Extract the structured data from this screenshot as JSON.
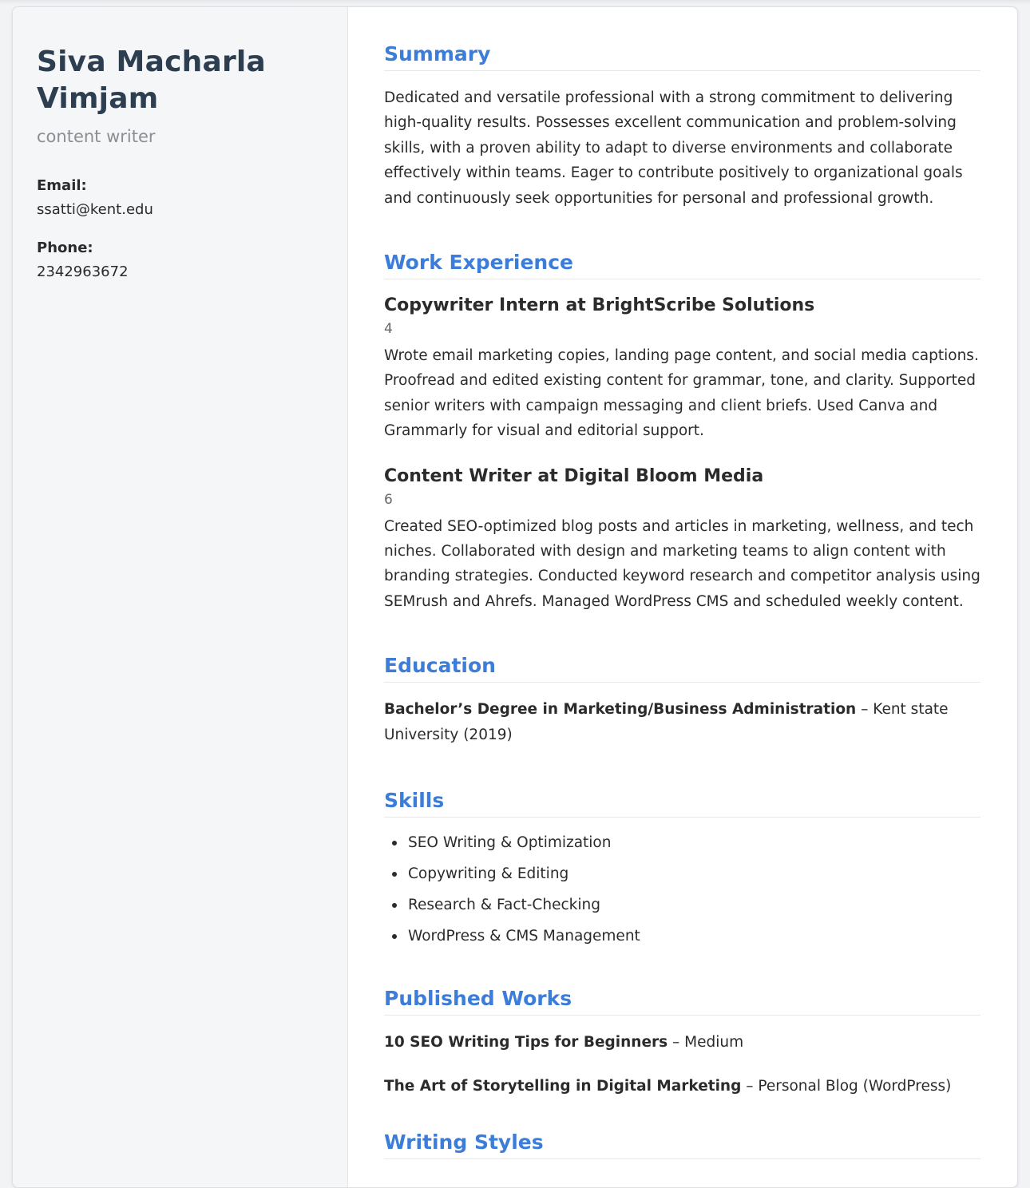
{
  "profile": {
    "name": "Siva Macharla Vimjam",
    "role": "content writer"
  },
  "contact": {
    "email_label": "Email:",
    "email": "ssatti@kent.edu",
    "phone_label": "Phone:",
    "phone": "2342963672"
  },
  "summary": {
    "title": "Summary",
    "text": "Dedicated and versatile professional with a strong commitment to delivering high-quality results. Possesses excellent communication and problem-solving skills, with a proven ability to adapt to diverse environments and collaborate effectively within teams. Eager to contribute positively to organizational goals and continuously seek opportunities for personal and professional growth."
  },
  "experience": {
    "title": "Work Experience",
    "jobs": [
      {
        "title": "Copywriter Intern at BrightScribe Solutions",
        "meta": "4",
        "description": "Wrote email marketing copies, landing page content, and social media captions. Proofread and edited existing content for grammar, tone, and clarity. Supported senior writers with campaign messaging and client briefs. Used Canva and Grammarly for visual and editorial support."
      },
      {
        "title": "Content Writer at Digital Bloom Media",
        "meta": "6",
        "description": "Created SEO-optimized blog posts and articles in marketing, wellness, and tech niches. Collaborated with design and marketing teams to align content with branding strategies. Conducted keyword research and competitor analysis using SEMrush and Ahrefs. Managed WordPress CMS and scheduled weekly content."
      }
    ]
  },
  "education": {
    "title": "Education",
    "degree": "Bachelor’s Degree in Marketing/Business Administration",
    "rest": " – Kent state University (2019)"
  },
  "skills": {
    "title": "Skills",
    "items": [
      "SEO Writing & Optimization",
      "Copywriting & Editing",
      "Research & Fact-Checking",
      "WordPress & CMS Management"
    ]
  },
  "published": {
    "title": "Published Works",
    "items": [
      {
        "name": "10 SEO Writing Tips for Beginners",
        "rest": " – Medium"
      },
      {
        "name": "The Art of Storytelling in Digital Marketing",
        "rest": " – Personal Blog (WordPress)"
      }
    ]
  },
  "styles": {
    "title": "Writing Styles"
  },
  "colors": {
    "accent": "#3b7dd8",
    "name": "#2c3e50",
    "sidebar_bg": "#f4f6f8"
  }
}
